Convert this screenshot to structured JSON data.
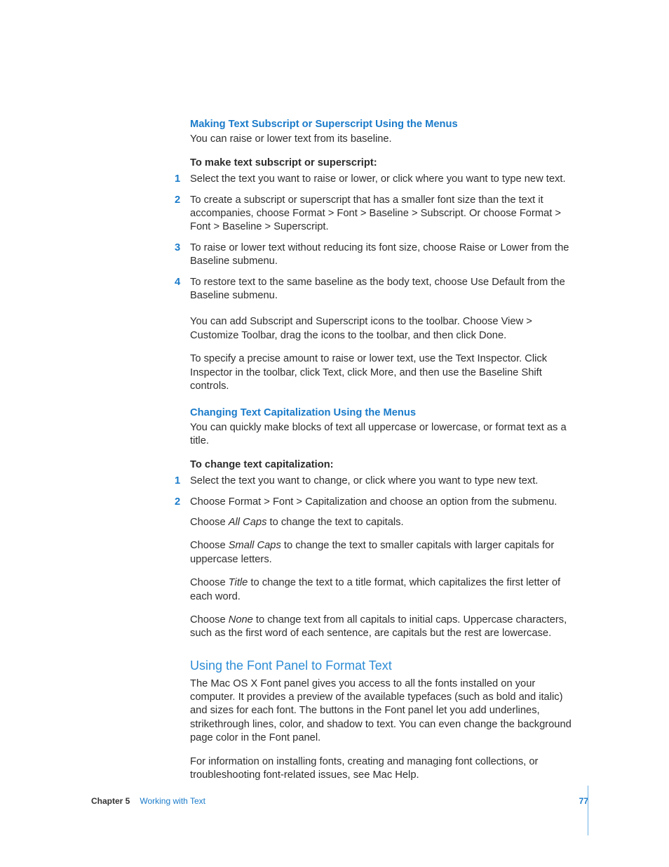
{
  "section1": {
    "heading": "Making Text Subscript or Superscript Using the Menus",
    "intro": "You can raise or lower text from its baseline.",
    "procHeading": "To make text subscript or superscript:",
    "steps": [
      "Select the text you want to raise or lower, or click where you want to type new text.",
      "To create a subscript or superscript that has a smaller font size than the text it accompanies, choose Format > Font > Baseline > Subscript. Or choose Format > Font > Baseline > Superscript.",
      "To raise or lower text without reducing its font size, choose Raise or Lower from the Baseline submenu.",
      "To restore text to the same baseline as the body text, choose Use Default from the Baseline submenu."
    ],
    "note1": "You can add Subscript and Superscript icons to the toolbar. Choose View > Customize Toolbar, drag the icons to the toolbar, and then click Done.",
    "note2": "To specify a precise amount to raise or lower text, use the Text Inspector. Click Inspector in the toolbar, click Text, click More, and then use the Baseline Shift controls."
  },
  "section2": {
    "heading": "Changing Text Capitalization Using the Menus",
    "intro": "You can quickly make blocks of text all uppercase or lowercase, or format text as a title.",
    "procHeading": "To change text capitalization:",
    "steps": [
      "Select the text you want to change, or click where you want to type new text.",
      "Choose Format > Font > Capitalization and choose an option from the submenu."
    ],
    "opt1_pre": "Choose ",
    "opt1_it": "All Caps",
    "opt1_post": " to change the text to capitals.",
    "opt2_pre": "Choose ",
    "opt2_it": "Small Caps",
    "opt2_post": " to change the text to smaller capitals with larger capitals for uppercase letters.",
    "opt3_pre": "Choose ",
    "opt3_it": "Title",
    "opt3_post": " to change the text to a title format, which capitalizes the first letter of each word.",
    "opt4_pre": "Choose ",
    "opt4_it": "None",
    "opt4_post": " to change text from all capitals to initial caps. Uppercase characters, such as the first word of each sentence, are capitals but the rest are lowercase."
  },
  "section3": {
    "heading": "Using the Font Panel to Format Text",
    "para1": "The Mac OS X Font panel gives you access to all the fonts installed on your computer. It provides a preview of the available typefaces (such as bold and italic) and sizes for each font. The buttons in the Font panel let you add underlines, strikethrough lines, color, and shadow to text. You can even change the background page color in the Font panel.",
    "para2": "For information on installing fonts, creating and managing font collections, or troubleshooting font-related issues, see Mac Help."
  },
  "footer": {
    "chapterLabel": "Chapter 5",
    "chapterTitle": "Working with Text",
    "pageNumber": "77"
  }
}
